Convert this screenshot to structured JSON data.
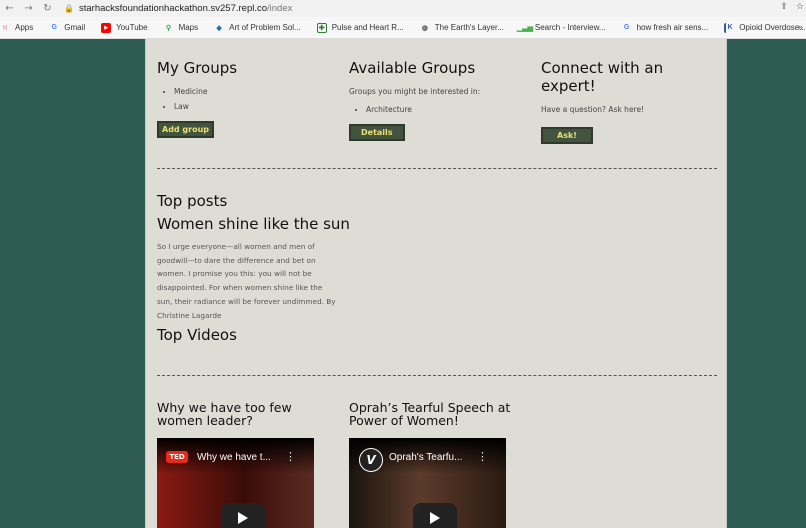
{
  "browser": {
    "url_domain": "starhacksfoundationhackathon.sv257.repl.co",
    "url_path": "/index",
    "bookmarks": [
      {
        "label": "Apps",
        "icon": "apps-grid-icon",
        "color": "#e0443b"
      },
      {
        "label": "Gmail",
        "icon": "google-icon",
        "color": "#4285f4"
      },
      {
        "label": "YouTube",
        "icon": "youtube-icon",
        "color": "#ff0000"
      },
      {
        "label": "Maps",
        "icon": "maps-pin-icon",
        "color": "#34a853"
      },
      {
        "label": "Art of Problem Sol...",
        "icon": "aops-icon",
        "color": "#1b72b8"
      },
      {
        "label": "Pulse and Heart R...",
        "icon": "pulse-icon",
        "color": "#2e7d32"
      },
      {
        "label": "The Earth's Layer...",
        "icon": "globe-icon",
        "color": "#555555"
      },
      {
        "label": "Search - Interview...",
        "icon": "chart-icon",
        "color": "#4caf50"
      },
      {
        "label": "how fresh air sens...",
        "icon": "google-icon",
        "color": "#4285f4"
      },
      {
        "label": "Opioid Overdose...",
        "icon": "k-icon",
        "color": "#2a5db0"
      }
    ]
  },
  "groups": {
    "my_title": "My Groups",
    "my_items": [
      "Medicine",
      "Law"
    ],
    "add_label": "Add group",
    "available_title": "Available Groups",
    "available_text": "Groups you might be interested in:",
    "available_items": [
      "Architecture"
    ],
    "details_label": "Details",
    "expert_title": "Connect with an expert!",
    "expert_text": "Have a question? Ask here!",
    "ask_label": "Ask!"
  },
  "posts": {
    "section_title": "Top posts",
    "post_title": "Women shine like the sun",
    "post_text": "So I urge everyone—all women and men of goodwill—to dare the difference and bet on women. I promise you this: you will not be disappointed. For when women shine like the sun, their radiance will be forever undimmed. By Christine Lagarde"
  },
  "videos": {
    "section_title": "Top Videos",
    "items": [
      {
        "heading": "Why we have too few women leader?",
        "thumb_title": "Why we have t...",
        "channel": "TED",
        "channel_color": "#e62b1e"
      },
      {
        "heading": "Oprah’s Tearful Speech at Power of Women!",
        "thumb_title": "Oprah's Tearfu...",
        "channel": "V",
        "channel_color": "#222222"
      }
    ]
  }
}
